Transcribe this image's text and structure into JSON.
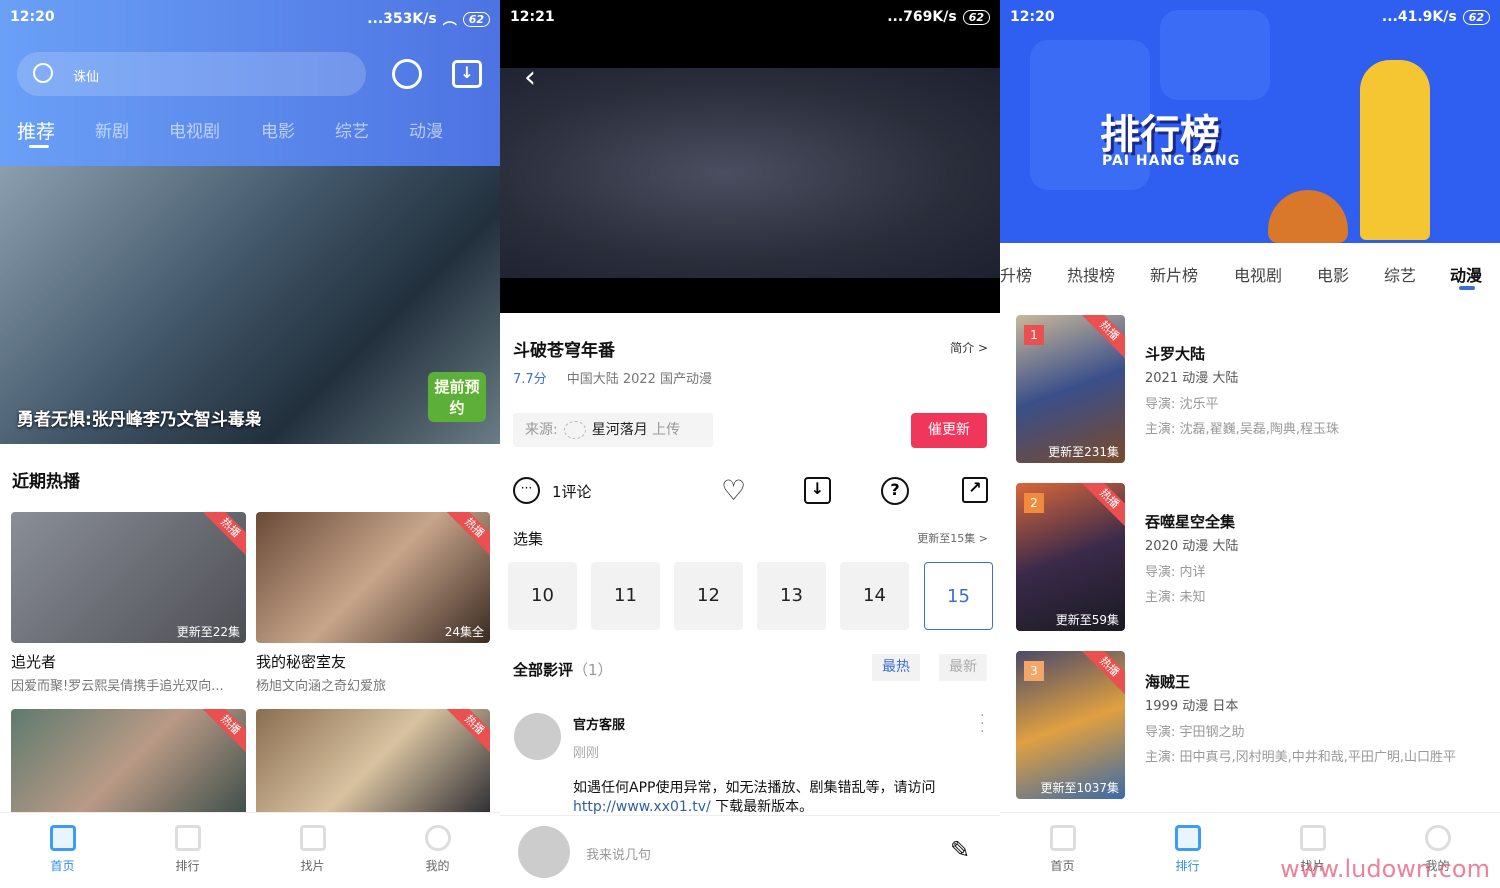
{
  "screen1": {
    "status": {
      "time": "12:20",
      "speed": "...353K/s",
      "battery": "62"
    },
    "search": {
      "value": "诛仙"
    },
    "tabs": [
      "推荐",
      "新剧",
      "电视剧",
      "电影",
      "综艺",
      "动漫"
    ],
    "banner": {
      "title": "勇者无惧:张丹峰李乃文智斗毒枭",
      "badge": "提前预约"
    },
    "section_title": "近期热播",
    "cards": [
      {
        "title": "追光者",
        "desc": "因爱而聚!罗云熙吴倩携手追光双向...",
        "tag": "热播",
        "caption": "更新至22集"
      },
      {
        "title": "我的秘密室友",
        "desc": "杨旭文向涵之奇幻爱旅",
        "tag": "热播",
        "caption": "24集全"
      },
      {
        "title": "",
        "desc": "",
        "tag": "热播",
        "caption": ""
      },
      {
        "title": "",
        "desc": "",
        "tag": "热播",
        "caption": ""
      }
    ],
    "nav": [
      "首页",
      "排行",
      "找片",
      "我的"
    ]
  },
  "screen2": {
    "status": {
      "time": "12:21",
      "speed": "...769K/s",
      "battery": "62"
    },
    "title": "斗破苍穹年番",
    "intro": "简介 >",
    "score": "7.7分",
    "meta": "中国大陆  2022  国产动漫",
    "source_label": "来源:",
    "uploader": "星河落月",
    "upload_suffix": "上传",
    "urge_button": "催更新",
    "comments_count": "1评论",
    "episodes_title": "选集",
    "episodes_status": "更新至15集 >",
    "episodes": [
      "10",
      "11",
      "12",
      "13",
      "14",
      "15"
    ],
    "reviews_title": "全部影评",
    "reviews_count": "（1）",
    "sort": [
      "最热",
      "最新"
    ],
    "comment": {
      "author": "官方客服",
      "time": "刚刚",
      "text": "如遇任何APP使用异常，如无法播放、剧集错乱等，请访问",
      "link": "http://www.xx01.tv/",
      "text2": " 下载最新版本。"
    },
    "input_placeholder": "我来说几句"
  },
  "screen3": {
    "status": {
      "time": "12:20",
      "speed": "...41.9K/s",
      "battery": "62"
    },
    "banner": {
      "title": "排行榜",
      "subtitle": "PAI HANG BANG"
    },
    "tabs": [
      "升榜",
      "热搜榜",
      "新片榜",
      "电视剧",
      "电影",
      "综艺",
      "动漫"
    ],
    "active_tab": "动漫",
    "items": [
      {
        "rank": "1",
        "tag": "热播",
        "caption": "更新至231集",
        "title": "斗罗大陆",
        "meta": "2021   动漫   大陆",
        "director": "导演: 沈乐平",
        "cast": "主演: 沈磊,翟巍,吴磊,陶典,程玉珠",
        "rank_color": "#e9504f"
      },
      {
        "rank": "2",
        "tag": "热播",
        "caption": "更新至59集",
        "title": "吞噬星空全集",
        "meta": "2020   动漫   大陆",
        "director": "导演: 内详",
        "cast": "主演: 未知",
        "rank_color": "#f08a3c"
      },
      {
        "rank": "3",
        "tag": "热播",
        "caption": "更新至1037集",
        "title": "海贼王",
        "meta": "1999   动漫   日本",
        "director": "导演: 宇田钢之助",
        "cast": "主演: 田中真弓,冈村明美,中井和哉,平田广明,山口胜平",
        "rank_color": "#f2a66a"
      }
    ],
    "nav": [
      "首页",
      "排行",
      "找片",
      "我的"
    ],
    "watermark": "www.ludown.com"
  },
  "colors": {
    "accent": "#3b6fd8",
    "urge": "#f0365a",
    "hot": "#e9504f"
  }
}
